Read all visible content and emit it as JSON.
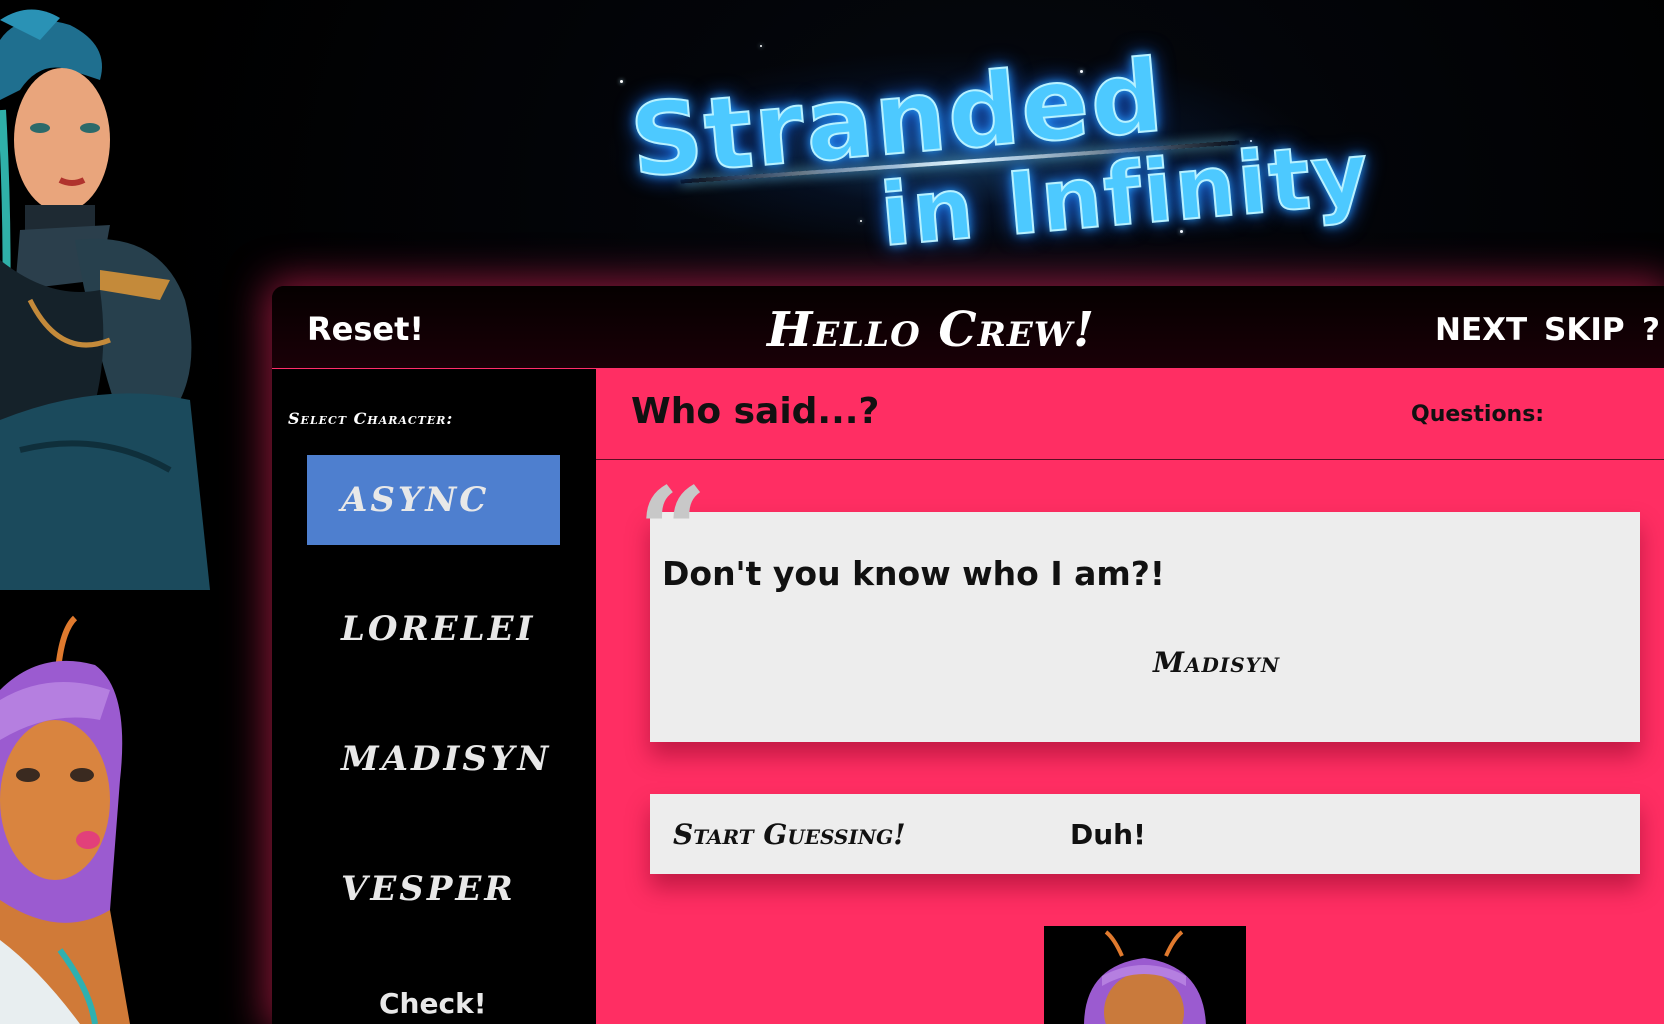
{
  "logo": {
    "line1": "Stranded",
    "line2": "in Infinity"
  },
  "topbar": {
    "reset_label": "Reset!",
    "title": "Hello Crew!",
    "next_label": "NEXT",
    "skip_label": "SKIP",
    "help_label": "?"
  },
  "sidebar": {
    "select_label": "Select Character:",
    "characters": [
      {
        "label": "ASYNC",
        "active": true
      },
      {
        "label": "LORELEI",
        "active": false
      },
      {
        "label": "MADISYN",
        "active": false
      },
      {
        "label": "VESPER",
        "active": false
      }
    ],
    "check_label": "Check!"
  },
  "content": {
    "heading": "Who said...?",
    "questions_label": "Questions:",
    "quote": {
      "mark": "“",
      "text": "Don't you know who I am?!",
      "author": "Madisyn"
    },
    "guess": {
      "prompt": "Start Guessing!",
      "value": "Duh!"
    }
  },
  "colors": {
    "accent_pink": "#ff2e63",
    "active_blue": "#4e7fcf",
    "card_bg": "#ededed",
    "logo_blue": "#4dc9ff"
  }
}
